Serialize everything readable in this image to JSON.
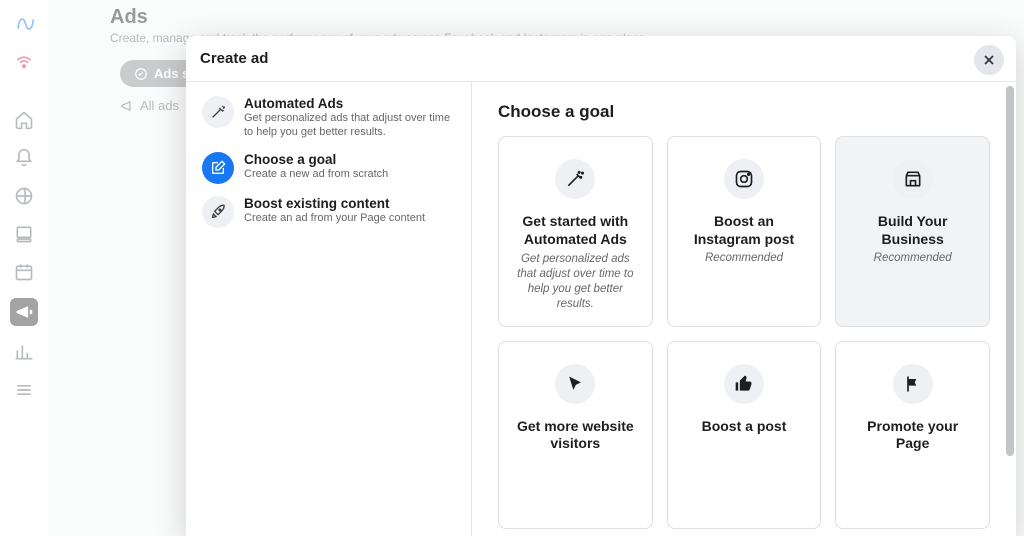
{
  "page": {
    "title": "Ads",
    "subtitle": "Create, manage and track the performance of your ads across Facebook and Instagram in one place."
  },
  "bg": {
    "ads_summary": "Ads s",
    "all_ads": "All ads"
  },
  "modal": {
    "title": "Create ad",
    "left_items": [
      {
        "label": "Automated Ads",
        "sub": "Get personalized ads that adjust over time to help you get better results."
      },
      {
        "label": "Choose a goal",
        "sub": "Create a new ad from scratch"
      },
      {
        "label": "Boost existing content",
        "sub": "Create an ad from your Page content"
      }
    ],
    "pane_title": "Choose a goal",
    "cards": [
      {
        "label": "Get started with Automated Ads",
        "desc": "Get personalized ads that adjust over time to help you get better results."
      },
      {
        "label": "Boost an Instagram post",
        "rec": "Recommended"
      },
      {
        "label": "Build Your Business",
        "rec": "Recommended"
      },
      {
        "label": "Get more website visitors"
      },
      {
        "label": "Boost a post"
      },
      {
        "label": "Promote your Page"
      }
    ]
  }
}
